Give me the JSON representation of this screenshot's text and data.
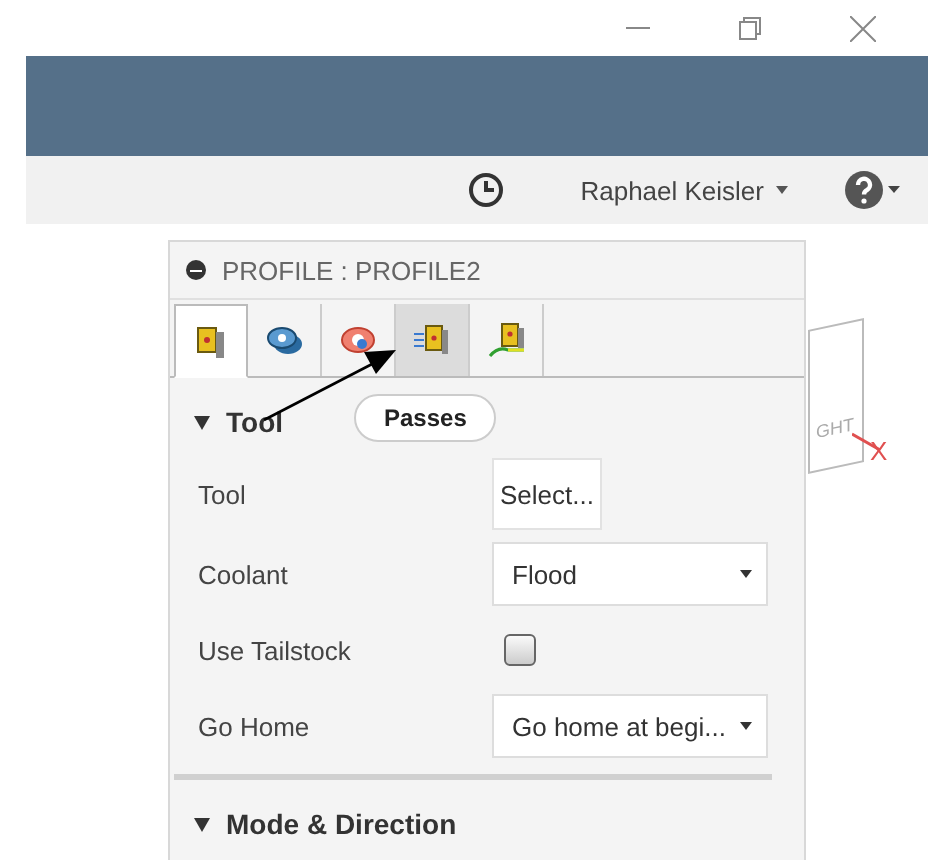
{
  "toolbar": {
    "user": "Raphael Keisler"
  },
  "panel": {
    "title": "PROFILE : PROFILE2",
    "tabs": [
      {
        "kind": "tool",
        "selected": true,
        "hovered": false
      },
      {
        "kind": "shape",
        "selected": false,
        "hovered": false
      },
      {
        "kind": "heights",
        "selected": false,
        "hovered": false
      },
      {
        "kind": "passes",
        "selected": false,
        "hovered": true
      },
      {
        "kind": "linking",
        "selected": false,
        "hovered": false
      }
    ],
    "tooltip": "Passes",
    "sections": [
      {
        "title": "Tool",
        "expanded": true,
        "rows": [
          {
            "kind": "button",
            "label": "Tool",
            "value": "Select..."
          },
          {
            "kind": "dropdown",
            "label": "Coolant",
            "value": "Flood"
          },
          {
            "kind": "checkbox",
            "label": "Use Tailstock",
            "checked": false
          },
          {
            "kind": "dropdown",
            "label": "Go Home",
            "value": "Go home at begi..."
          }
        ]
      },
      {
        "title": "Mode & Direction",
        "expanded": true
      }
    ]
  },
  "viewcube": {
    "face_label": "GHT",
    "axis_label": "X"
  }
}
